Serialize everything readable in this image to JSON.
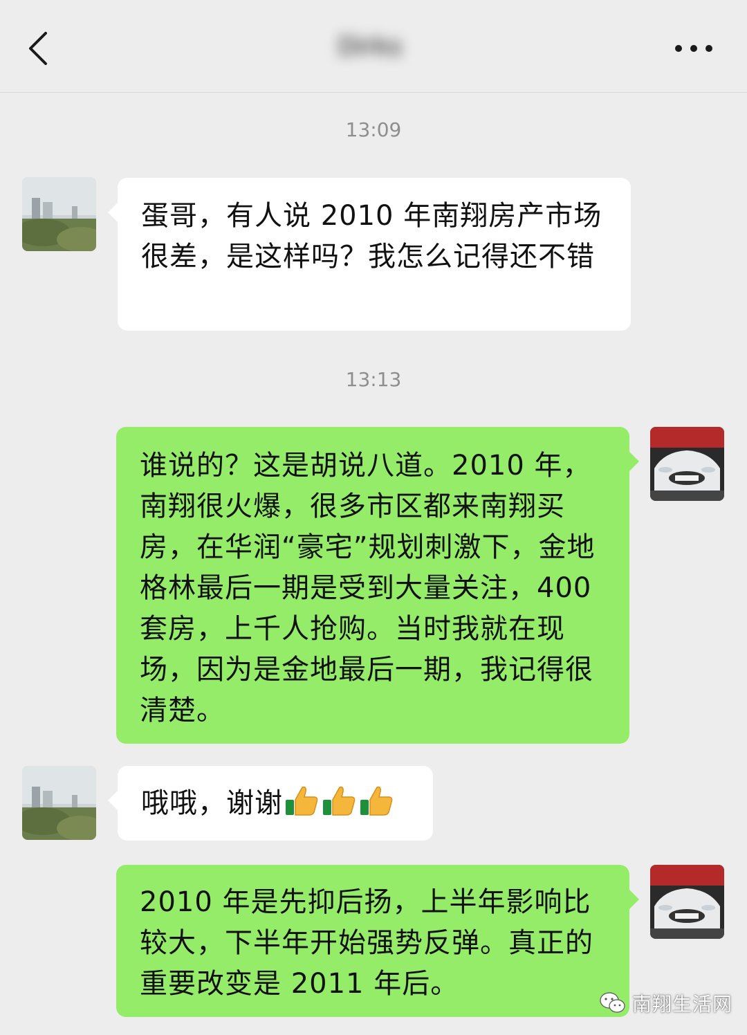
{
  "header": {
    "title": "Dirks",
    "back_icon": "chevron-left-icon",
    "more_icon": "more-dots-icon"
  },
  "messages": [
    {
      "type": "timestamp",
      "text": "13:09"
    },
    {
      "type": "incoming",
      "text": "蛋哥，有人说 2010 年南翔房产市场很差，是这样吗？我怎么记得还不错"
    },
    {
      "type": "timestamp",
      "text": "13:13"
    },
    {
      "type": "outgoing",
      "text": "谁说的？这是胡说八道。2010 年，南翔很火爆，很多市区都来南翔买房，在华润“豪宅”规划刺激下，金地格林最后一期是受到大量关注，400 套房，上千人抢购。当时我就在现场，因为是金地最后一期，我记得很清楚。"
    },
    {
      "type": "incoming",
      "text": "哦哦，谢谢",
      "emoji": "thumbs-up-icon",
      "emoji_count": 3
    },
    {
      "type": "outgoing",
      "text": "2010 年是先抑后扬，上半年影响比较大，下半年开始强势反弹。真正的重要改变是 2011 年后。"
    }
  ],
  "watermark": {
    "text": "南翔生活网",
    "icon": "wechat-logo-icon"
  },
  "colors": {
    "background": "#ededed",
    "incoming_bubble": "#ffffff",
    "outgoing_bubble": "#95ec69",
    "timestamp": "#8e8e8e"
  }
}
